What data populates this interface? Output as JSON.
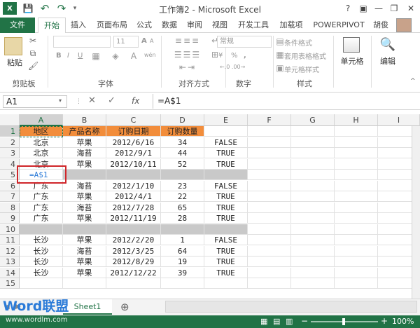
{
  "window": {
    "title": "工作簿2 - Microsoft Excel",
    "help": "?",
    "minimize": "—",
    "restore": "❐",
    "close": "✕",
    "user": "胡俊"
  },
  "qat": {
    "save": "💾",
    "undo": "↶",
    "redo": "↷"
  },
  "tabs": [
    "文件",
    "开始",
    "插入",
    "页面布局",
    "公式",
    "数据",
    "审阅",
    "视图",
    "开发工具",
    "加载项",
    "POWERPIVOT"
  ],
  "ribbon": {
    "clipboard": {
      "paste": "粘贴",
      "label": "剪贴板"
    },
    "font": {
      "size": "11",
      "label": "字体",
      "bold": "B",
      "italic": "I",
      "underline": "U",
      "grow": "A",
      "shrink": "A",
      "wen": "wén"
    },
    "alignment": {
      "label": "对齐方式"
    },
    "number": {
      "format": "常规",
      "label": "数字",
      "percent": "%",
      "comma": ","
    },
    "styles": {
      "cond_format": "条件格式",
      "table_format": "套用表格格式",
      "cell_style": "单元格样式",
      "label": "样式"
    },
    "cells": {
      "label": "单元格"
    },
    "editing": {
      "label": "编辑"
    }
  },
  "formula_bar": {
    "name_box": "A1",
    "cancel": "✕",
    "enter": "✓",
    "fx": "fx",
    "formula": "=A$1"
  },
  "columns": [
    "A",
    "B",
    "C",
    "D",
    "E",
    "F",
    "G",
    "H",
    "I"
  ],
  "rows": [
    {
      "num": "1",
      "cells": [
        "地区",
        "产品名称",
        "订购日期",
        "订购数量",
        ""
      ],
      "header": true
    },
    {
      "num": "2",
      "cells": [
        "北京",
        "苹果",
        "2012/6/16",
        "34",
        "FALSE"
      ]
    },
    {
      "num": "3",
      "cells": [
        "北京",
        "海苔",
        "2012/9/1",
        "44",
        "TRUE"
      ]
    },
    {
      "num": "4",
      "cells": [
        "北京",
        "苹果",
        "2012/10/11",
        "52",
        "TRUE"
      ]
    },
    {
      "num": "5",
      "cells": [
        "=A$1",
        "",
        "",
        "",
        ""
      ],
      "blank": true
    },
    {
      "num": "6",
      "cells": [
        "广东",
        "海苔",
        "2012/1/10",
        "23",
        "FALSE"
      ]
    },
    {
      "num": "7",
      "cells": [
        "广东",
        "苹果",
        "2012/4/1",
        "22",
        "TRUE"
      ]
    },
    {
      "num": "8",
      "cells": [
        "广东",
        "海苔",
        "2012/7/28",
        "65",
        "TRUE"
      ]
    },
    {
      "num": "9",
      "cells": [
        "广东",
        "苹果",
        "2012/11/19",
        "28",
        "TRUE"
      ]
    },
    {
      "num": "10",
      "cells": [
        "",
        "",
        "",
        "",
        ""
      ],
      "blank": true
    },
    {
      "num": "11",
      "cells": [
        "长沙",
        "苹果",
        "2012/2/20",
        "1",
        "FALSE"
      ]
    },
    {
      "num": "12",
      "cells": [
        "长沙",
        "海苔",
        "2012/3/25",
        "64",
        "TRUE"
      ]
    },
    {
      "num": "13",
      "cells": [
        "长沙",
        "苹果",
        "2012/8/29",
        "19",
        "TRUE"
      ]
    },
    {
      "num": "14",
      "cells": [
        "长沙",
        "苹果",
        "2012/12/22",
        "39",
        "TRUE"
      ]
    },
    {
      "num": "15",
      "cells": [
        "",
        "",
        "",
        "",
        ""
      ]
    }
  ],
  "sheet": {
    "tab": "Sheet1",
    "add": "⊕"
  },
  "watermark": {
    "brand": "Word联盟",
    "url": "www.wordlm.com"
  },
  "status": {
    "zoom": "100%",
    "zoom_minus": "−",
    "zoom_plus": "+"
  },
  "colors": {
    "accent": "#217346",
    "header_fill": "#f28d3b",
    "blank_fill": "#c9c9c9",
    "highlight": "#d0262a"
  }
}
